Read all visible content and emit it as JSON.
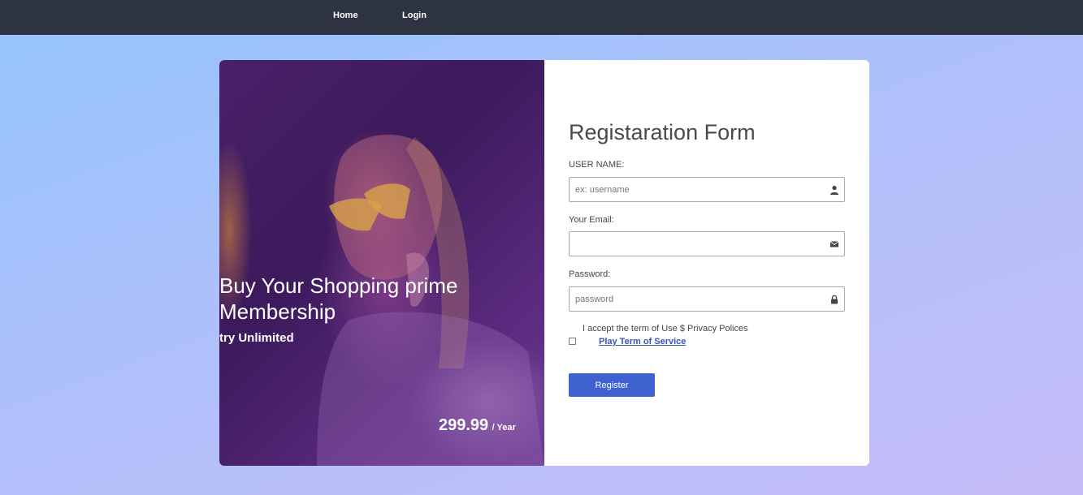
{
  "nav": {
    "home_label": "Home",
    "login_label": "Login"
  },
  "promo": {
    "title": "Buy Your Shopping prime Membership",
    "subtitle": "try Unlimited",
    "price": "299.99",
    "period": "/ Year"
  },
  "form": {
    "title": "Registaration Form",
    "username_label": "USER NAME:",
    "username_placeholder": "ex: username",
    "username_value": "",
    "email_label": "Your Email:",
    "email_placeholder": "",
    "email_value": "",
    "password_label": "Password:",
    "password_placeholder": "password",
    "password_value": "",
    "terms_text": "I accept the term of Use $ Privacy Polices",
    "terms_link": "Play Term of Service",
    "register_label": "Register"
  },
  "icons": {
    "username": "user-icon",
    "email": "envelope-icon",
    "password": "lock-icon"
  },
  "colors": {
    "nav_background": "#2d3340",
    "button": "#3e62d0",
    "link": "#3a55b4"
  }
}
